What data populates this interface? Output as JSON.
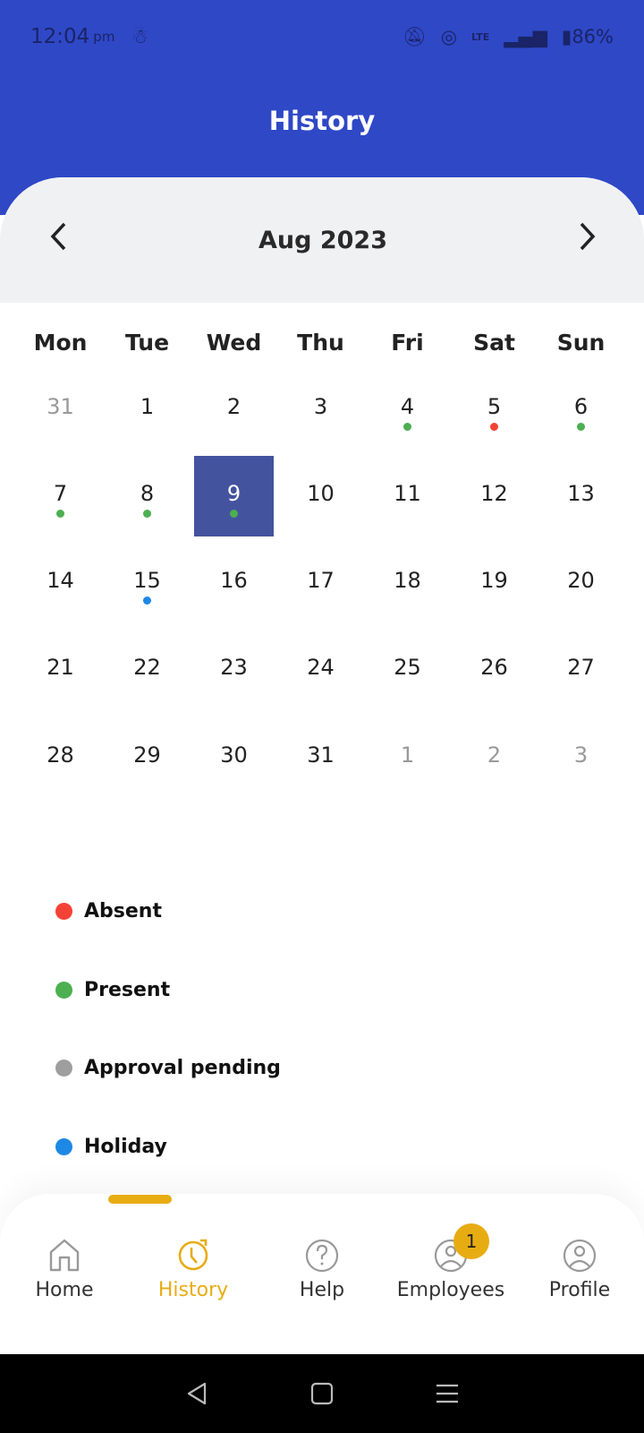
{
  "status_bar": {
    "time": "12:04",
    "ampm": "pm",
    "battery": "86%",
    "network": "LTE"
  },
  "header": {
    "title": "History"
  },
  "calendar": {
    "month_label": "Aug 2023",
    "weekdays": [
      "Mon",
      "Tue",
      "Wed",
      "Thu",
      "Fri",
      "Sat",
      "Sun"
    ],
    "weeks": [
      [
        {
          "d": "31",
          "other": true
        },
        {
          "d": "1"
        },
        {
          "d": "2"
        },
        {
          "d": "3"
        },
        {
          "d": "4",
          "status": "present"
        },
        {
          "d": "5",
          "status": "absent"
        },
        {
          "d": "6",
          "status": "present"
        }
      ],
      [
        {
          "d": "7",
          "status": "present"
        },
        {
          "d": "8",
          "status": "present"
        },
        {
          "d": "9",
          "status": "present",
          "selected": true
        },
        {
          "d": "10"
        },
        {
          "d": "11"
        },
        {
          "d": "12"
        },
        {
          "d": "13"
        }
      ],
      [
        {
          "d": "14"
        },
        {
          "d": "15",
          "status": "holiday"
        },
        {
          "d": "16"
        },
        {
          "d": "17"
        },
        {
          "d": "18"
        },
        {
          "d": "19"
        },
        {
          "d": "20"
        }
      ],
      [
        {
          "d": "21"
        },
        {
          "d": "22"
        },
        {
          "d": "23"
        },
        {
          "d": "24"
        },
        {
          "d": "25"
        },
        {
          "d": "26"
        },
        {
          "d": "27"
        }
      ],
      [
        {
          "d": "28"
        },
        {
          "d": "29"
        },
        {
          "d": "30"
        },
        {
          "d": "31"
        },
        {
          "d": "1",
          "other": true
        },
        {
          "d": "2",
          "other": true
        },
        {
          "d": "3",
          "other": true
        }
      ]
    ]
  },
  "status_colors": {
    "absent": "#F44336",
    "present": "#4CAF50",
    "pending": "#9E9E9E",
    "holiday": "#1E88E5"
  },
  "legend": [
    {
      "label": "Absent",
      "key": "absent"
    },
    {
      "label": "Present",
      "key": "present"
    },
    {
      "label": "Approval pending",
      "key": "pending"
    },
    {
      "label": "Holiday",
      "key": "holiday"
    }
  ],
  "bottom_nav": {
    "items": [
      {
        "label": "Home",
        "icon": "home-icon"
      },
      {
        "label": "History",
        "icon": "history-icon",
        "active": true
      },
      {
        "label": "Help",
        "icon": "help-icon"
      },
      {
        "label": "Employees",
        "icon": "employees-icon",
        "badge": "1"
      },
      {
        "label": "Profile",
        "icon": "profile-icon"
      }
    ],
    "accent": "#E8AC13"
  }
}
